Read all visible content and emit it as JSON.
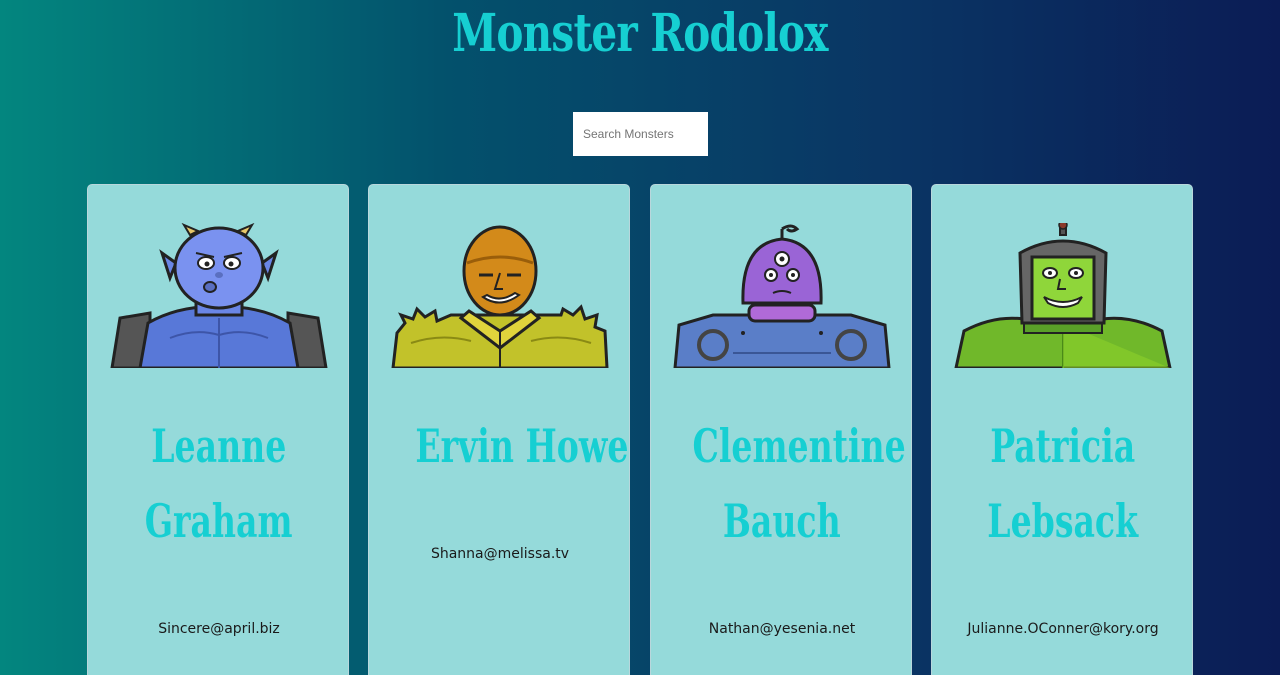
{
  "app": {
    "title": "Monster Rodolox"
  },
  "search": {
    "placeholder": "Search Monsters",
    "value": ""
  },
  "monsters": [
    {
      "name_line1": "Leanne",
      "name_line2": "Graham",
      "email": "Sincere@april.biz",
      "avatar_icon": "blue-monster-avatar"
    },
    {
      "name_line1": "Ervin Howell",
      "name_line2": "",
      "email": "Shanna@melissa.tv",
      "avatar_icon": "yellow-monster-avatar"
    },
    {
      "name_line1": "Clementine",
      "name_line2": "Bauch",
      "email": "Nathan@yesenia.net",
      "avatar_icon": "purple-cyclops-monster-avatar"
    },
    {
      "name_line1": "Patricia",
      "name_line2": "Lebsack",
      "email": "Julianne.OConner@kory.org",
      "avatar_icon": "green-helmet-monster-avatar"
    }
  ],
  "colors": {
    "title": "#16cfd2",
    "card_background": "#95dada",
    "background_gradient": [
      "#03867f",
      "#0b1c55"
    ]
  }
}
